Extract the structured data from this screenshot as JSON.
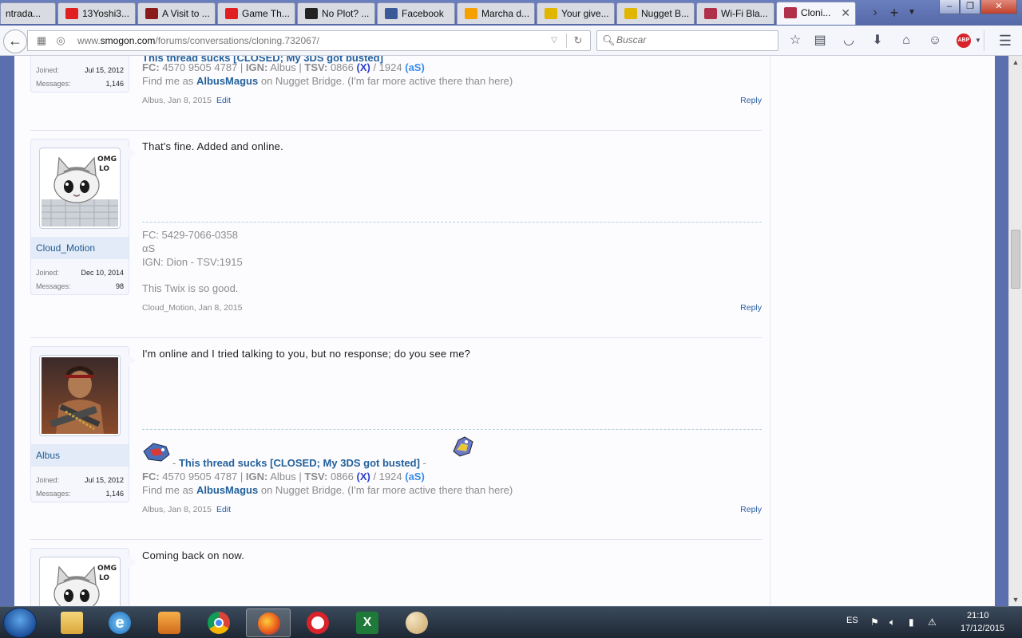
{
  "browser": {
    "tabs": [
      {
        "label": "ntrada...",
        "favicon_color": "#cfd3dd"
      },
      {
        "label": "13Yoshi3...",
        "favicon_color": "#e02020"
      },
      {
        "label": "A Visit to ...",
        "favicon_color": "#8b1a1a"
      },
      {
        "label": "Game Th...",
        "favicon_color": "#e02020"
      },
      {
        "label": "No Plot? ...",
        "favicon_color": "#222222"
      },
      {
        "label": "Facebook",
        "favicon_color": "#3b5998"
      },
      {
        "label": "Marcha d...",
        "favicon_color": "#f5a000"
      },
      {
        "label": "Your give...",
        "favicon_color": "#e0b600"
      },
      {
        "label": "Nugget B...",
        "favicon_color": "#e0b600"
      },
      {
        "label": "Wi-Fi Bla...",
        "favicon_color": "#b0304a"
      },
      {
        "label": "Cloni...",
        "favicon_color": "#b0304a"
      }
    ],
    "url_prefix": "www.",
    "url_domain": "smogon.com",
    "url_path": "/forums/conversations/cloning.732067/",
    "search_placeholder": "Buscar",
    "abp_label": "ABP"
  },
  "posts": [
    {
      "username": "",
      "joined_label": "Joined:",
      "joined": "Jul 15, 2012",
      "messages_label": "Messages:",
      "messages": "1,146",
      "sig_fc_label": "FC:",
      "sig_fc": "4570 9505 4787 |",
      "sig_ign_label": "IGN:",
      "sig_ign": "Albus |",
      "sig_tsv_label": "TSV:",
      "sig_tsv": "0866",
      "sig_x": "(X)",
      "sig_tsv2": "/ 1924",
      "sig_as": "(aS)",
      "sig_find_pre": "Find me as",
      "sig_find_name": "AlbusMagus",
      "sig_find_post": "on Nugget Bridge. (I'm far more active there than here)",
      "author": "Albus,",
      "date": "Jan 8, 2015",
      "edit": "Edit",
      "reply": "Reply"
    },
    {
      "username": "Cloud_Motion",
      "joined_label": "Joined:",
      "joined": "Dec 10, 2014",
      "messages_label": "Messages:",
      "messages": "98",
      "message": "That's fine. Added and online.",
      "sig_line1": "FC: 5429-7066-0358",
      "sig_line2": "αS",
      "sig_line3": "IGN: Dion - TSV:1915",
      "sig_line4": "This Twix is so good.",
      "author": "Cloud_Motion,",
      "date": "Jan 8, 2015",
      "reply": "Reply",
      "avatar_text": "OMG\nLO"
    },
    {
      "username": "Albus",
      "joined_label": "Joined:",
      "joined": "Jul 15, 2012",
      "messages_label": "Messages:",
      "messages": "1,146",
      "message": "I'm online and I tried talking to you, but no response; do you see me?",
      "sig_title_dash": "-",
      "sig_title": "This thread sucks [CLOSED; My 3DS got busted]",
      "sig_title_dash2": "-",
      "sig_fc_label": "FC:",
      "sig_fc": "4570 9505 4787 |",
      "sig_ign_label": "IGN:",
      "sig_ign": "Albus |",
      "sig_tsv_label": "TSV:",
      "sig_tsv": "0866",
      "sig_x": "(X)",
      "sig_tsv2": "/ 1924",
      "sig_as": "(aS)",
      "sig_find_pre": "Find me as",
      "sig_find_name": "AlbusMagus",
      "sig_find_post": "on Nugget Bridge. (I'm far more active there than here)",
      "author": "Albus,",
      "date": "Jan 8, 2015",
      "edit": "Edit",
      "reply": "Reply"
    },
    {
      "message": "Coming back on now.",
      "avatar_text": "OMG\nLO"
    }
  ],
  "taskbar": {
    "lang": "ES",
    "time": "21:10",
    "date": "17/12/2015"
  }
}
